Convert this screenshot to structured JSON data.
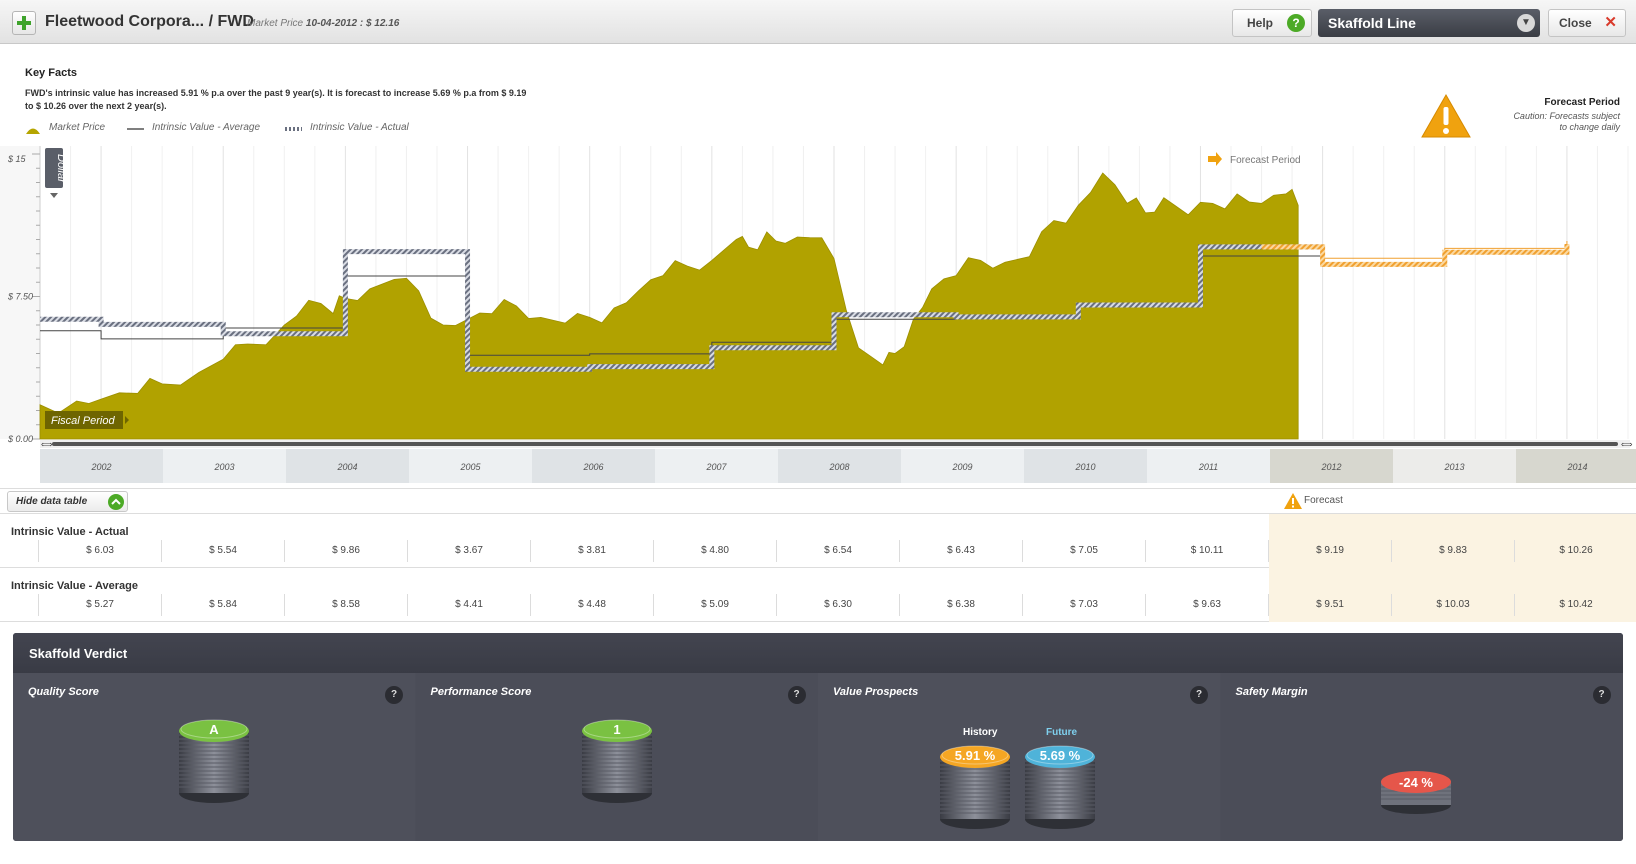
{
  "header": {
    "title": "Fleetwood Corpora... / FWD",
    "market_price_label": "Market Price",
    "market_price_date": "10-04-2012",
    "market_price_value": ": $ 12.16",
    "help_label": "Help",
    "help_icon": "?",
    "view_select": "Skaffold Line",
    "close_label": "Close",
    "close_icon": "✕"
  },
  "key_facts": {
    "title": "Key Facts",
    "text": "FWD's intrinsic value has increased 5.91 % p.a over the past 9 year(s). It is forecast to increase 5.69 % p.a from $ 9.19 to $ 10.26 over the next 2 year(s).",
    "legend": {
      "market_price": "Market Price",
      "iv_average": "Intrinsic Value - Average",
      "iv_actual": "Intrinsic Value - Actual"
    },
    "forecast_title": "Forecast Period",
    "forecast_caution_1": "Caution: Forecasts subject",
    "forecast_caution_2": "to change daily"
  },
  "chart_data": {
    "type": "area",
    "unit_toggle": "Dollar",
    "fiscal_period_label": "Fiscal Period",
    "forecast_period_label": "Forecast Period",
    "y_ticks": [
      "$ 15",
      "$ 7.50",
      "$ 0.00"
    ],
    "ylim": [
      0,
      15
    ],
    "x_ticks": [
      "2002",
      "2003",
      "2004",
      "2005",
      "2006",
      "2007",
      "2008",
      "2009",
      "2010",
      "2011",
      "2012",
      "2013",
      "2014"
    ],
    "market_price": {
      "name": "Market Price",
      "x": [
        2001.5,
        2001.8,
        2002.0,
        2002.3,
        2002.5,
        2002.8,
        2003.0,
        2003.2,
        2003.5,
        2003.7,
        2003.9,
        2004.0,
        2004.2,
        2004.4,
        2004.6,
        2004.8,
        2005.0,
        2005.2,
        2005.4,
        2005.6,
        2005.8,
        2006.0,
        2006.2,
        2006.4,
        2006.6,
        2006.8,
        2007.0,
        2007.2,
        2007.3,
        2007.45,
        2007.6,
        2007.8,
        2008.0,
        2008.2,
        2008.4,
        2008.5,
        2008.65,
        2008.8,
        2009.0,
        2009.2,
        2009.4,
        2009.6,
        2009.8,
        2010.0,
        2010.2,
        2010.4,
        2010.55,
        2010.7,
        2010.9,
        2011.1,
        2011.3,
        2011.5,
        2011.7,
        2011.8
      ],
      "values": [
        1.8,
        2.0,
        2.1,
        2.4,
        2.9,
        3.5,
        4.2,
        5.0,
        6.0,
        7.3,
        6.6,
        7.4,
        7.9,
        8.4,
        7.8,
        6.0,
        6.3,
        6.6,
        7.0,
        6.4,
        6.1,
        6.4,
        6.9,
        7.8,
        8.6,
        9.1,
        9.4,
        10.5,
        10.1,
        10.9,
        10.3,
        10.6,
        9.5,
        4.8,
        3.9,
        4.5,
        6.3,
        7.9,
        8.6,
        9.4,
        9.3,
        9.6,
        11.5,
        12.3,
        14.0,
        12.4,
        11.9,
        12.7,
        11.8,
        12.4,
        12.9,
        12.4,
        12.9,
        12.3
      ]
    },
    "iv_actual": {
      "name": "Intrinsic Value - Actual",
      "periods": [
        2001.5,
        2002.0,
        2003.0,
        2004.0,
        2005.0,
        2006.0,
        2007.0,
        2008.0,
        2009.0,
        2010.0,
        2011.0,
        2012.0,
        2013.0,
        2014.0
      ],
      "values": [
        6.3,
        6.03,
        5.54,
        9.86,
        3.67,
        3.81,
        4.8,
        6.54,
        6.43,
        7.05,
        10.11,
        9.19,
        9.83,
        10.26
      ]
    },
    "iv_average": {
      "name": "Intrinsic Value - Average",
      "values": [
        5.7,
        5.27,
        5.84,
        8.58,
        4.41,
        4.48,
        5.09,
        6.3,
        6.38,
        7.03,
        9.63,
        9.51,
        10.03,
        10.42
      ]
    },
    "forecast_start": 2011.5,
    "xlim": [
      2001.5,
      2014.5
    ]
  },
  "table": {
    "hide_label": "Hide data table",
    "forecast_label": "Forecast",
    "rows": [
      {
        "label": "Intrinsic Value - Actual",
        "values": [
          "$ 6.03",
          "$ 5.54",
          "$ 9.86",
          "$ 3.67",
          "$ 3.81",
          "$ 4.80",
          "$ 6.54",
          "$ 6.43",
          "$ 7.05",
          "$ 10.11",
          "$ 9.19",
          "$ 9.83",
          "$ 10.26"
        ]
      },
      {
        "label": "Intrinsic Value - Average",
        "values": [
          "$ 5.27",
          "$ 5.84",
          "$ 8.58",
          "$ 4.41",
          "$ 4.48",
          "$ 5.09",
          "$ 6.30",
          "$ 6.38",
          "$ 7.03",
          "$ 9.63",
          "$ 9.51",
          "$ 10.03",
          "$ 10.42"
        ]
      }
    ]
  },
  "verdict": {
    "title": "Skaffold Verdict",
    "panels": [
      {
        "title": "Quality Score",
        "help": "?",
        "value": "A",
        "color": "#7ac142"
      },
      {
        "title": "Performance Score",
        "help": "?",
        "value": "1",
        "color": "#7ac142"
      },
      {
        "title": "Value Prospects",
        "help": "?",
        "history_label": "History",
        "history_value": "5.91 %",
        "history_color": "#f5a623",
        "future_label": "Future",
        "future_value": "5.69 %",
        "future_color": "#4fb3d9"
      },
      {
        "title": "Safety Margin",
        "help": "?",
        "value": "-24 %",
        "color": "#e5564a"
      }
    ]
  }
}
